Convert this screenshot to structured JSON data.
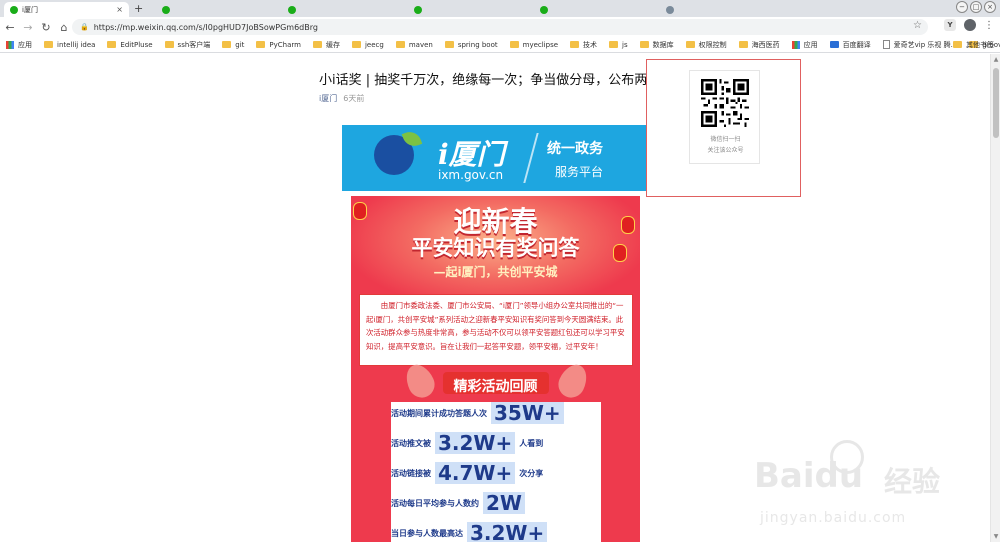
{
  "browser": {
    "active_tab": {
      "title": "i厦门",
      "close": "×"
    },
    "inactive_tabs": [
      {
        "title": ""
      },
      {
        "title": ""
      },
      {
        "title": ""
      },
      {
        "title": ""
      },
      {
        "title": ""
      }
    ],
    "new_tab": "+",
    "window_controls": [
      "−",
      "□",
      "×"
    ],
    "url": "https://mp.weixin.qq.com/s/I0pgHUD7JoBSowPGm6dBrg",
    "extension_label": "Y"
  },
  "bookmarks": {
    "apps_label": "应用",
    "items": [
      "intellij idea",
      "EditPluse",
      "ssh客户端",
      "git",
      "PyCharm",
      "缓存",
      "jeecg",
      "maven",
      "spring boot",
      "myeclipse",
      "技术",
      "js",
      "数据库",
      "权限控制",
      "海西医药",
      "应用",
      "百度翻译",
      "爱奇艺vip 乐视 腾...",
      "groovy",
      "idea"
    ],
    "other": "其他书签"
  },
  "article": {
    "title": "小i话奖 | 抽奖千万次，绝缘每一次；争当做分母，公布两行泪！",
    "account": "i厦门",
    "time": "6天前"
  },
  "banner": {
    "brand": "i厦门",
    "url": "ixm.gov.cn",
    "line1": "统一政务",
    "line2": "服务平台"
  },
  "poster": {
    "title1": "迎新春",
    "title2": "平安知识有奖问答",
    "subtitle": "—起i厦门，共创平安城",
    "notice": "由厦门市委政法委、厦门市公安局、“i厦门”领导小组办公室共同推出的“一起i厦门，共创平安城”系列活动之迎新春平安知识有奖问答到今天圆满结束。此次活动群众参与热度非常高，参与活动不仅可以领平安答题红包还可以学习平安知识，提高平安意识。旨在让我们一起答平安题，领平安福，过平安年！",
    "section_title": "精彩活动回顾",
    "stats": [
      {
        "pre": "活动期间累计成功答题人次",
        "num": "35W+",
        "post": ""
      },
      {
        "pre": "活动推文被",
        "num": "3.2W+",
        "post": "人看到"
      },
      {
        "pre": "活动链接被",
        "num": "4.7W+",
        "post": "次分享"
      },
      {
        "pre": "活动每日平均参与人数约",
        "num": "2W",
        "post": ""
      },
      {
        "pre": "当日参与人数最高达",
        "num": "3.2W+",
        "post": ""
      }
    ]
  },
  "qr": {
    "line1": "微信扫一扫",
    "line2": "关注该公众号"
  },
  "watermark": {
    "brand": "Bai",
    "brand2": "du",
    "cn": "经验",
    "url": "jingyan.baidu.com"
  }
}
